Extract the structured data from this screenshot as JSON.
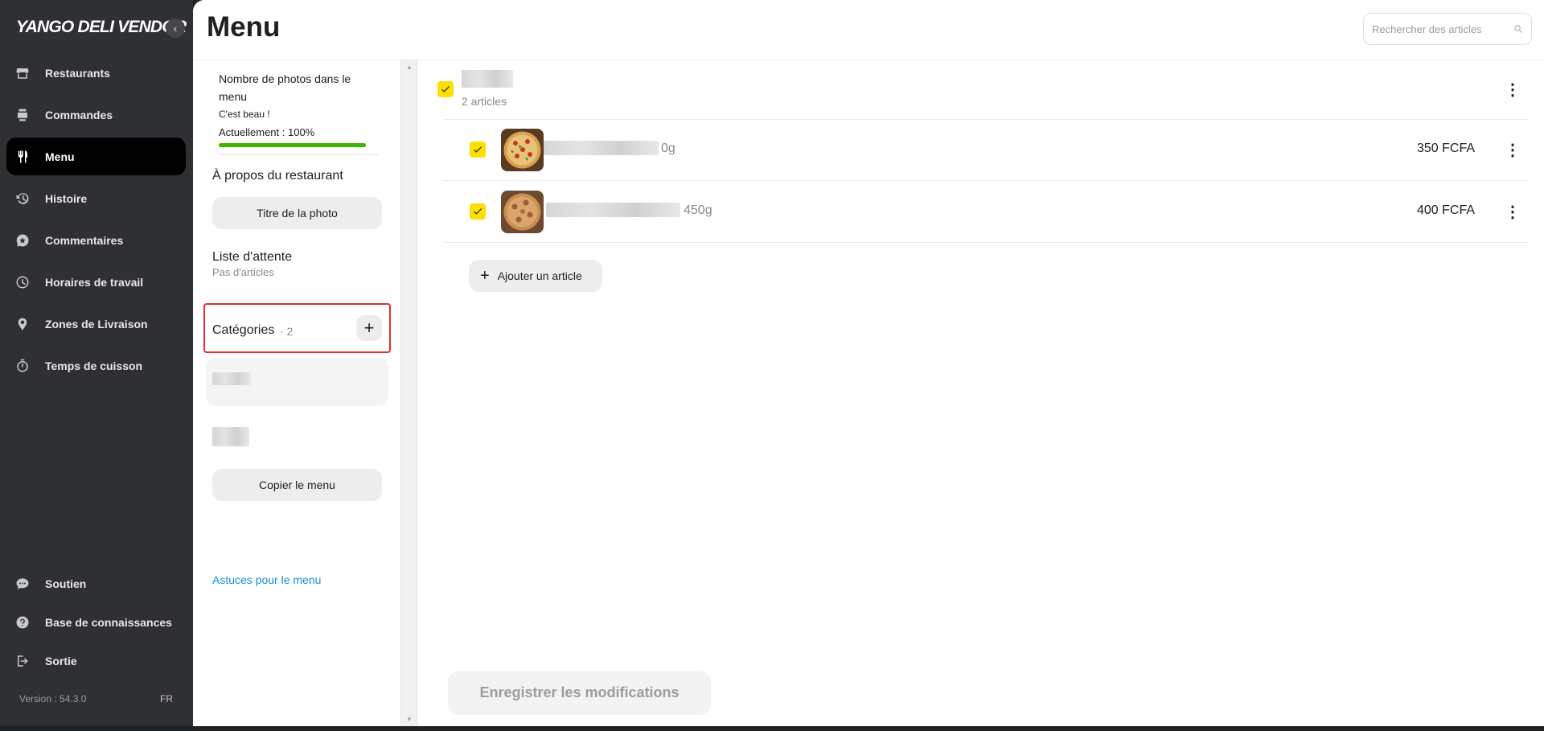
{
  "app": {
    "brand": "YANGO DELI VENDOR",
    "collapse_icon": "‹"
  },
  "nav": {
    "items": [
      {
        "label": "Restaurants",
        "icon": "store-icon"
      },
      {
        "label": "Commandes",
        "icon": "order-icon"
      },
      {
        "label": "Menu",
        "icon": "fork-knife-icon",
        "active": true
      },
      {
        "label": "Histoire",
        "icon": "history-icon"
      },
      {
        "label": "Commentaires",
        "icon": "comment-star-icon"
      },
      {
        "label": "Horaires de travail",
        "icon": "clock-icon"
      },
      {
        "label": "Zones de Livraison",
        "icon": "location-pin-icon"
      },
      {
        "label": "Temps de cuisson",
        "icon": "timer-icon"
      }
    ],
    "bottom_items": [
      {
        "label": "Soutien",
        "icon": "chat-icon"
      },
      {
        "label": "Base de connaissances",
        "icon": "help-icon"
      },
      {
        "label": "Sortie",
        "icon": "logout-icon"
      }
    ],
    "version": "Version : 54.3.0",
    "lang": "FR"
  },
  "header": {
    "title": "Menu",
    "search_placeholder": "Rechercher des articles"
  },
  "panel": {
    "photos_title": "Nombre de photos dans le menu",
    "photos_sub": "C'est beau !",
    "photos_current": "Actuellement : 100%",
    "photos_progress": 1.0,
    "about_title": "À propos du restaurant",
    "photo_title_button": "Titre de la photo",
    "wait_title": "Liste d'attente",
    "wait_sub": "Pas d'articles",
    "categories_title": "Catégories",
    "categories_count": "· 2",
    "copy_menu_button": "Copier le menu",
    "tips_link": "Astuces pour le menu"
  },
  "category": {
    "subtitle": "2 articles",
    "items": [
      {
        "weight": "0g",
        "price": "350 FCFA"
      },
      {
        "weight": "450g",
        "price": "400 FCFA"
      }
    ],
    "add_article": "Ajouter un article"
  },
  "footer": {
    "save_button": "Enregistrer les modifications"
  },
  "colors": {
    "accent_yellow": "#fce000",
    "sidebar": "#2f3033",
    "progress_green": "#3bb300",
    "highlight_red": "#e22f2f",
    "link_blue": "#1a8fd8"
  }
}
